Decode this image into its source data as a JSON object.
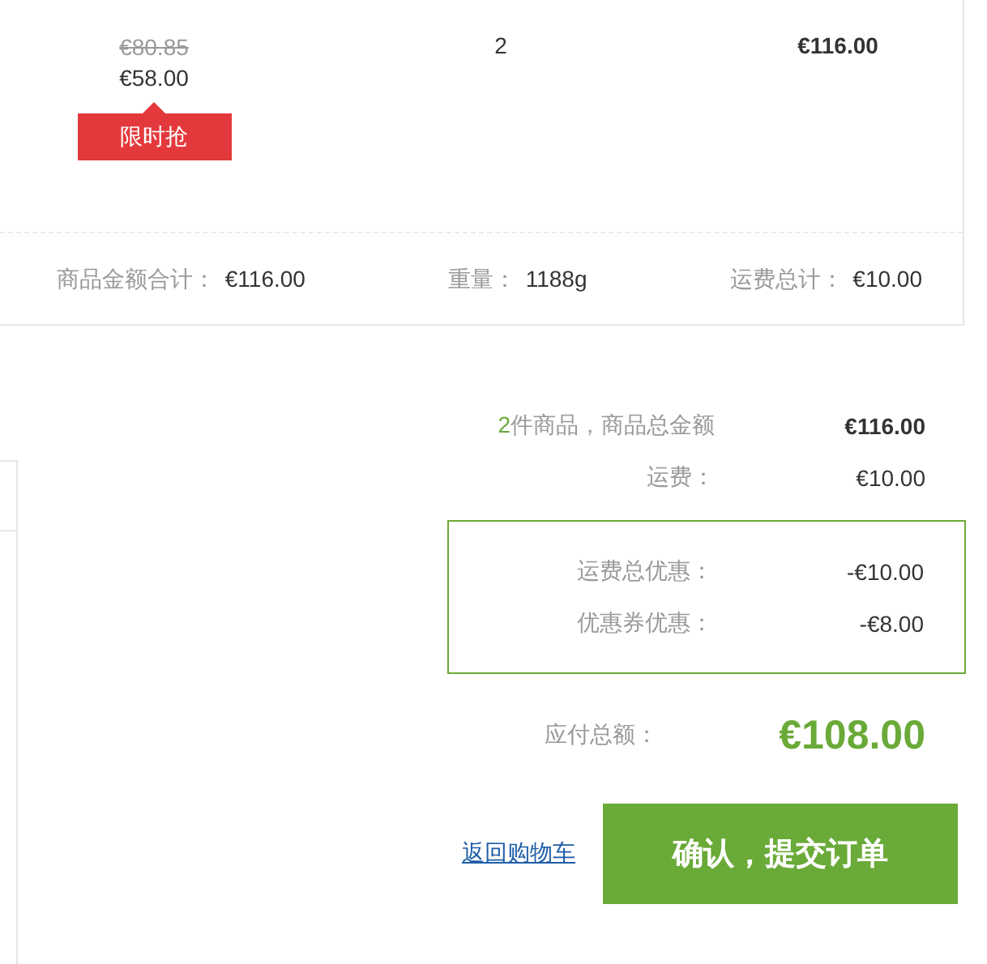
{
  "item": {
    "original_price": "€80.85",
    "price": "€58.00",
    "badge": "限时抢",
    "quantity": "2",
    "subtotal": "€116.00"
  },
  "totals": [
    {
      "label": "商品金额合计：",
      "value": "€116.00"
    },
    {
      "label": "重量：",
      "value": "1188g"
    },
    {
      "label": "运费总计：",
      "value": "€10.00"
    }
  ],
  "summary": {
    "count": "2",
    "count_label": "件商品，商品总金额",
    "goods_total": "€116.00",
    "shipping_label": "运费：",
    "shipping": "€10.00"
  },
  "discounts": [
    {
      "label": "运费总优惠：",
      "value": "-€10.00"
    },
    {
      "label": "优惠券优惠：",
      "value": "-€8.00"
    }
  ],
  "payable": {
    "label": "应付总额：",
    "value": "€108.00"
  },
  "back_link": "返回购物车",
  "submit_button": "确认，提交订单"
}
